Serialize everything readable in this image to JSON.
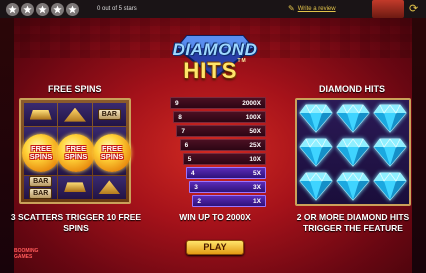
{
  "review_bar": {
    "stars_count": 5,
    "rating_text": "0 out of 5 stars",
    "write_review": "Write a review"
  },
  "logo": {
    "line1": "DIAMOND",
    "line2": "HITS",
    "tm": "TM"
  },
  "free_spins": {
    "title": "FREE SPINS",
    "coin_line1": "FREE",
    "coin_line2": "SPINS",
    "caption": "3 SCATTERS TRIGGER 10 FREE SPINS"
  },
  "multipliers": {
    "rows": [
      {
        "n": "9",
        "value": "2000X",
        "active": false
      },
      {
        "n": "8",
        "value": "100X",
        "active": false
      },
      {
        "n": "7",
        "value": "50X",
        "active": false
      },
      {
        "n": "6",
        "value": "25X",
        "active": false
      },
      {
        "n": "5",
        "value": "10X",
        "active": false
      },
      {
        "n": "4",
        "value": "5X",
        "active": true
      },
      {
        "n": "3",
        "value": "3X",
        "active": true
      },
      {
        "n": "2",
        "value": "1X",
        "active": true
      }
    ],
    "caption": "WIN UP TO 2000X"
  },
  "diamond_hits": {
    "title": "DIAMOND HITS",
    "caption": "2 OR MORE DIAMOND HITS TRIGGER THE FEATURE"
  },
  "play_label": "PLAY",
  "brand": {
    "line1": "BOOMING",
    "line2": "GAMES"
  },
  "colors": {
    "accent_gold": "#e1c34a",
    "bg_red": "#a5121a",
    "rung_active": "#5b2bb8"
  }
}
